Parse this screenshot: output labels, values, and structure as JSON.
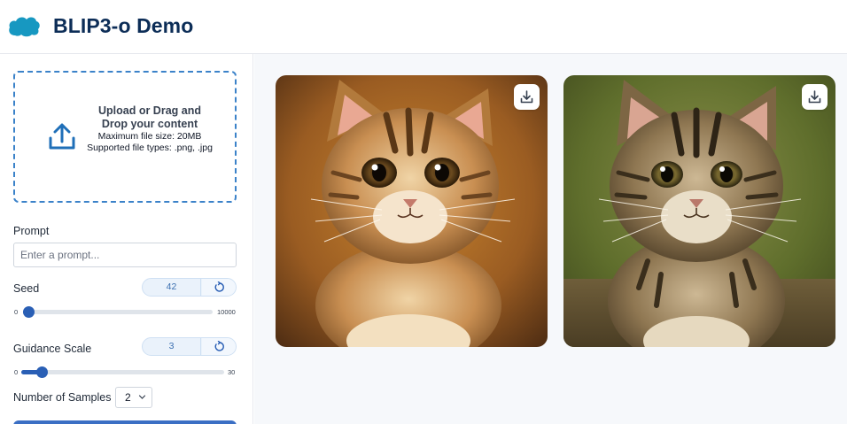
{
  "app": {
    "title": "BLIP3-o Demo"
  },
  "upload": {
    "title": "Upload or Drag and Drop your content",
    "max_size": "Maximum file size: 20MB",
    "types": "Supported file types: .png, .jpg"
  },
  "prompt": {
    "label": "Prompt",
    "placeholder": "Enter a prompt...",
    "value": ""
  },
  "seed": {
    "label": "Seed",
    "value": "42",
    "min": "0",
    "max": "10000",
    "level": 0.0042
  },
  "guidance": {
    "label": "Guidance Scale",
    "value": "3",
    "min": "0",
    "max": "30",
    "level": 0.1
  },
  "samples": {
    "label": "Number of Samples",
    "value": "2"
  },
  "gallery": {
    "images": [
      {
        "subject": "tabby kitten, warm brown background",
        "icon": "download-icon"
      },
      {
        "subject": "tabby kitten, green blurred background",
        "icon": "download-icon"
      }
    ]
  },
  "colors": {
    "accent": "#2a5fb5",
    "title": "#0c2d57",
    "brand_cloud": "#1798c1"
  }
}
